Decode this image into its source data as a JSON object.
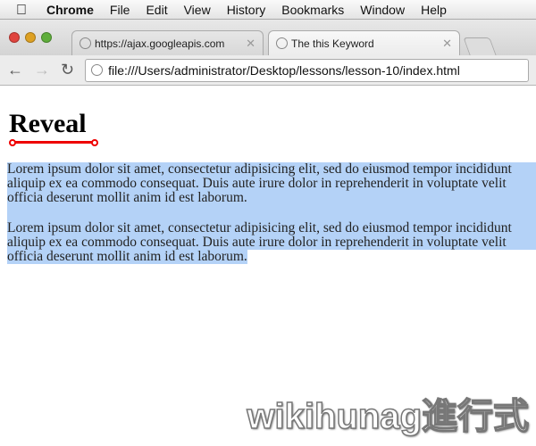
{
  "menubar": {
    "app": "Chrome",
    "items": [
      "File",
      "Edit",
      "View",
      "History",
      "Bookmarks",
      "Window",
      "Help"
    ]
  },
  "tabs": [
    {
      "title": "https://ajax.googleapis.com"
    },
    {
      "title": "The this Keyword"
    }
  ],
  "toolbar": {
    "url": "file:///Users/administrator/Desktop/lessons/lesson-10/index.html"
  },
  "page": {
    "heading": "Reveal",
    "paragraphs": [
      {
        "lines": [
          "Lorem ipsum dolor sit amet, consectetur adipisicing elit, sed do eiusmod tempor incididunt",
          "aliquip ex ea commodo consequat. Duis aute irure dolor in reprehenderit in voluptate velit",
          "officia deserunt mollit anim id est laborum."
        ]
      },
      {
        "lines": [
          "Lorem ipsum dolor sit amet, consectetur adipisicing elit, sed do eiusmod tempor incididunt",
          "aliquip ex ea commodo consequat. Duis aute irure dolor in reprehenderit in voluptate velit",
          "officia deserunt mollit anim id est laborum."
        ]
      }
    ]
  },
  "colors": {
    "selection": "#b4d2f7",
    "underline": "#e00000"
  },
  "watermark": "wikihunag進行式"
}
